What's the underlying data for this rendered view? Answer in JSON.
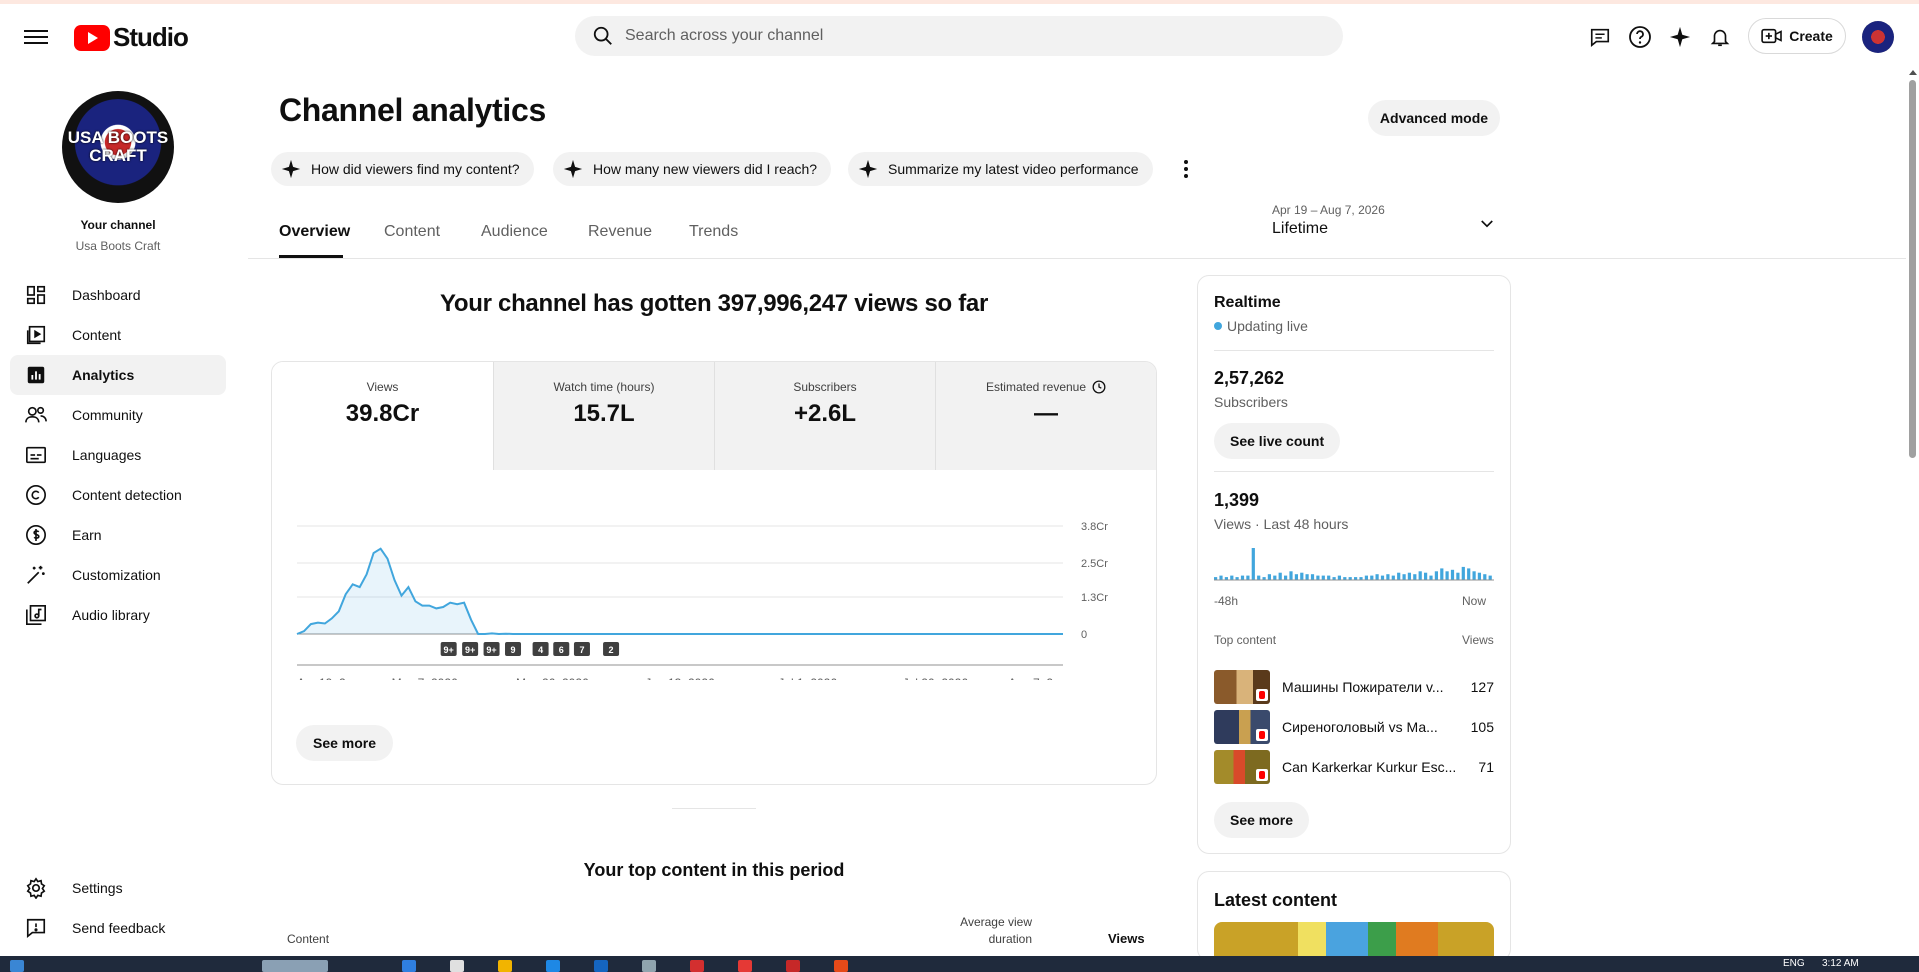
{
  "header": {
    "app_name": "Studio",
    "search_placeholder": "Search across your channel",
    "create_label": "Create"
  },
  "sidebar": {
    "channel_label": "Your channel",
    "channel_name": "Usa Boots Craft",
    "avatar_text": "USA BOOTS CRAFT",
    "items": [
      {
        "label": "Dashboard",
        "icon": "dashboard-icon"
      },
      {
        "label": "Content",
        "icon": "content-icon"
      },
      {
        "label": "Analytics",
        "icon": "analytics-icon",
        "active": true
      },
      {
        "label": "Community",
        "icon": "community-icon"
      },
      {
        "label": "Languages",
        "icon": "languages-icon"
      },
      {
        "label": "Content detection",
        "icon": "copyright-icon"
      },
      {
        "label": "Earn",
        "icon": "dollar-icon"
      },
      {
        "label": "Customization",
        "icon": "magic-wand-icon"
      },
      {
        "label": "Audio library",
        "icon": "audio-library-icon"
      }
    ],
    "bottom": [
      {
        "label": "Settings",
        "icon": "gear-icon"
      },
      {
        "label": "Send feedback",
        "icon": "feedback-icon"
      }
    ]
  },
  "main": {
    "title": "Channel analytics",
    "advanced_mode": "Advanced mode",
    "chips": [
      "How did viewers find my content?",
      "How many new viewers did I reach?",
      "Summarize my latest video performance"
    ],
    "tabs": [
      "Overview",
      "Content",
      "Audience",
      "Revenue",
      "Trends"
    ],
    "date_range": {
      "dates": "Apr 19 – Aug 7, 2026",
      "label": "Lifetime"
    },
    "headline": "Your channel has gotten 397,996,247 views so far",
    "metrics": [
      {
        "label": "Views",
        "value": "39.8Cr"
      },
      {
        "label": "Watch time (hours)",
        "value": "15.7L"
      },
      {
        "label": "Subscribers",
        "value": "+2.6L"
      },
      {
        "label": "Estimated revenue",
        "value": "—"
      }
    ],
    "see_more": "See more",
    "top_content_title": "Your top content in this period",
    "table_headers": {
      "content": "Content",
      "avd_line1": "Average view",
      "avd_line2": "duration",
      "views": "Views"
    }
  },
  "chart_data": {
    "type": "area",
    "x_ticks": [
      "Apr 19, 2...",
      "May 7, 2026",
      "May 26, 2026",
      "Jun 13, 2026",
      "Jul 1, 2026",
      "Jul 20, 2026",
      "Aug 7, 2..."
    ],
    "y_ticks": [
      "3.8Cr",
      "2.5Cr",
      "1.3Cr",
      "0"
    ],
    "ylim": [
      0,
      3.8
    ],
    "y_unit": "Cr",
    "values": [
      0.0,
      0.1,
      0.35,
      0.4,
      0.37,
      0.55,
      0.8,
      1.4,
      1.75,
      1.65,
      2.1,
      2.85,
      3.0,
      2.65,
      1.9,
      1.35,
      1.65,
      1.15,
      1.0,
      1.0,
      0.9,
      0.95,
      1.1,
      1.05,
      1.1,
      0.5,
      0.0,
      0.0,
      0.02,
      0.0,
      0.01,
      0.0,
      0.0,
      0.0,
      0.0,
      0.0,
      0.0,
      0.0,
      0.0,
      0.0,
      0.0,
      0.0,
      0.0,
      0.0,
      0.0,
      0.0,
      0.0,
      0.0,
      0.0,
      0.0,
      0.0,
      0.0,
      0.0,
      0.0,
      0.0,
      0.0,
      0.0,
      0.0,
      0.0,
      0.0,
      0.0,
      0.0,
      0.0,
      0.0,
      0.0,
      0.0,
      0.0,
      0.0,
      0.0,
      0.0,
      0.0,
      0.0,
      0.0,
      0.0,
      0.0,
      0.0,
      0.0,
      0.0,
      0.0,
      0.0,
      0.0,
      0.0,
      0.0,
      0.0,
      0.0,
      0.0,
      0.0,
      0.0,
      0.0,
      0.0,
      0.0,
      0.0,
      0.0,
      0.0,
      0.0,
      0.0,
      0.0,
      0.0,
      0.0,
      0.0,
      0.0,
      0.0,
      0.0,
      0.0,
      0.0,
      0.0,
      0.0,
      0.0,
      0.0,
      0.0,
      0.0
    ],
    "markers": [
      "9+",
      "9+",
      "9+",
      "9",
      "4",
      "6",
      "7",
      "2"
    ],
    "marker_positions": [
      0.198,
      0.226,
      0.254,
      0.282,
      0.318,
      0.345,
      0.372,
      0.41
    ],
    "color": "#41a6dd"
  },
  "realtime": {
    "title": "Realtime",
    "live": "Updating live",
    "subscribers_value": "2,57,262",
    "subscribers_label": "Subscribers",
    "see_live_count": "See live count",
    "views_value": "1,399",
    "views_label": "Views · Last 48 hours",
    "bar_values": [
      2,
      3,
      2,
      3,
      2,
      3,
      3,
      22,
      3,
      2,
      4,
      3,
      5,
      3,
      6,
      4,
      5,
      4,
      4,
      3,
      3,
      3,
      2,
      3,
      2,
      2,
      2,
      2,
      3,
      3,
      4,
      3,
      4,
      3,
      5,
      4,
      5,
      4,
      6,
      5,
      3,
      6,
      8,
      6,
      7,
      5,
      9,
      8,
      6,
      5,
      4,
      3
    ],
    "axis_left": "-48h",
    "axis_right": "Now",
    "top_content_label": "Top content",
    "views_col": "Views",
    "top_content": [
      {
        "title": "Машины Пожиратели v...",
        "views": "127",
        "thumb": "#8a5a2b"
      },
      {
        "title": "Сиреноголовый vs Ма...",
        "views": "105",
        "thumb": "#2f3b5c"
      },
      {
        "title": "Can Karkerkar Kurkur Esc...",
        "views": "71",
        "thumb": "#a38b2a"
      }
    ],
    "see_more": "See more",
    "latest_title": "Latest content"
  },
  "taskbar": {
    "lang": "ENG",
    "time": "3:12 AM"
  },
  "colors": {
    "accent": "#41a6dd",
    "brand_red": "#ff0000",
    "chip_bg": "#f2f2f2"
  }
}
